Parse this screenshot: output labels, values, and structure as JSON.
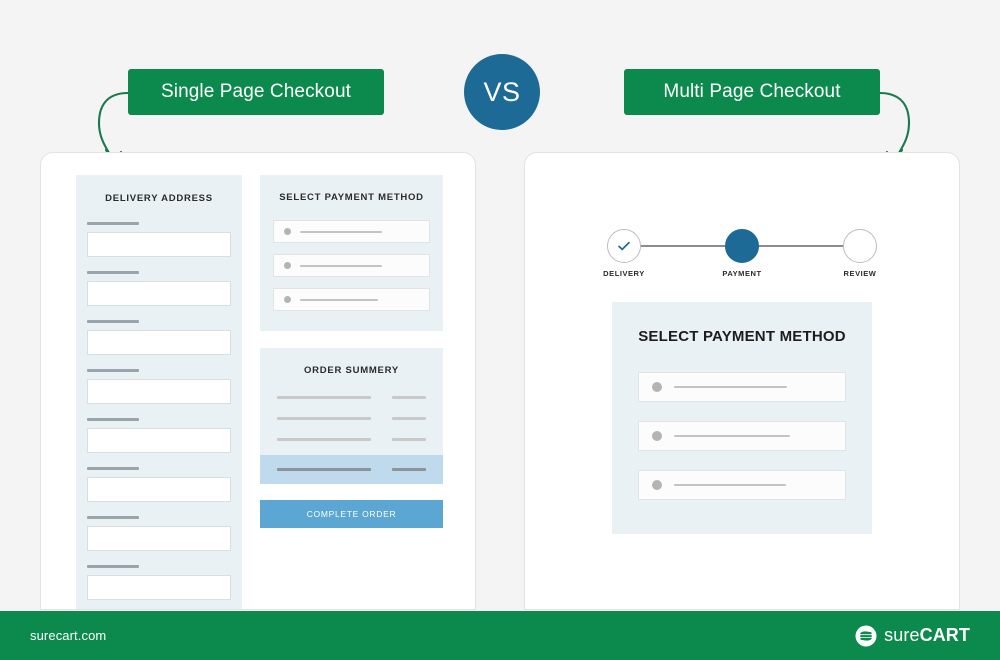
{
  "page": {
    "background_color": "#f4f4f4",
    "brand_green": "#0c8a4d",
    "brand_blue": "#1d6a96",
    "accent_blue": "#5ba6d2",
    "panel_blue": "#eaf1f5",
    "total_band_blue": "#bfdaec"
  },
  "header": {
    "left_label": "Single Page Checkout",
    "vs_label": "VS",
    "right_label": "Multi Page Checkout",
    "left_arrow_icon": "curved-arrow-down-left-icon",
    "right_arrow_icon": "curved-arrow-down-right-icon"
  },
  "single_page": {
    "delivery": {
      "title": "DELIVERY ADDRESS",
      "field_count": 8
    },
    "payment": {
      "title": "SELECT PAYMENT METHOD",
      "options": [
        {
          "dot_icon": "radio-dot-icon"
        },
        {
          "dot_icon": "radio-dot-icon"
        },
        {
          "dot_icon": "radio-dot-icon"
        }
      ]
    },
    "summary": {
      "title": "ORDER SUMMERY",
      "rows": [
        {
          "label_placeholder": true,
          "value_placeholder": true
        },
        {
          "label_placeholder": true,
          "value_placeholder": true
        },
        {
          "label_placeholder": true,
          "value_placeholder": true
        }
      ],
      "total_row": {
        "label_placeholder": true,
        "value_placeholder": true
      },
      "complete_button": "COMPLETE ORDER"
    }
  },
  "multi_page": {
    "stepper": {
      "steps": [
        {
          "label": "DELIVERY",
          "state": "done",
          "icon": "check-icon"
        },
        {
          "label": "PAYMENT",
          "state": "active",
          "icon": "filled-dot-icon"
        },
        {
          "label": "REVIEW",
          "state": "todo",
          "icon": "empty-circle-icon"
        }
      ]
    },
    "payment": {
      "title": "SELECT PAYMENT METHOD",
      "options": [
        {
          "dot_icon": "radio-dot-icon"
        },
        {
          "dot_icon": "radio-dot-icon"
        },
        {
          "dot_icon": "radio-dot-icon"
        }
      ]
    }
  },
  "footer": {
    "url": "surecart.com",
    "logo_mark_icon": "surecart-circle-mark-icon",
    "logo_text_light": "sure",
    "logo_text_bold": "CART"
  }
}
